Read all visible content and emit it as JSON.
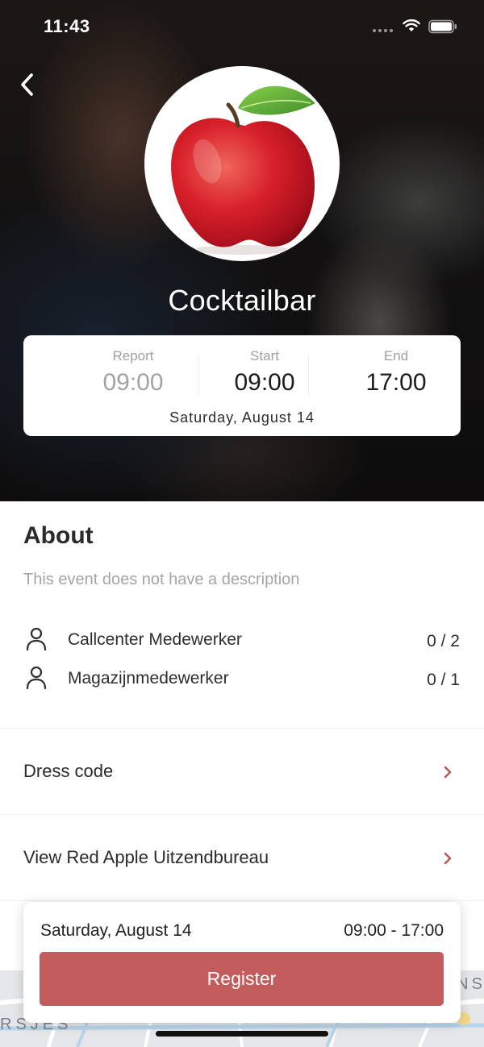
{
  "status_bar": {
    "time": "11:43"
  },
  "event": {
    "title": "Cocktailbar",
    "logo_icon": "red-apple"
  },
  "schedule": {
    "report_label": "Report",
    "report_time": "09:00",
    "start_label": "Start",
    "start_time": "09:00",
    "end_label": "End",
    "end_time": "17:00",
    "date": "Saturday, August 14"
  },
  "about": {
    "title": "About",
    "description": "This event does not have a description",
    "positions": [
      {
        "name": "Callcenter Medewerker",
        "count": "0 / 2",
        "icon": "person-icon"
      },
      {
        "name": "Magazijnmedewerker",
        "count": "0 / 1",
        "icon": "person-icon"
      }
    ]
  },
  "links": {
    "dress_code": "Dress code",
    "agency": "View Red Apple Uitzendbureau"
  },
  "map": {
    "label_left": "RSJES",
    "label_right": "NS"
  },
  "footer": {
    "date": "Saturday, August 14",
    "time_range": "09:00 - 17:00",
    "register_label": "Register"
  },
  "colors": {
    "accent": "#c35c5c",
    "chevron": "#b55a5a",
    "muted_text": "#a5a5a5"
  }
}
